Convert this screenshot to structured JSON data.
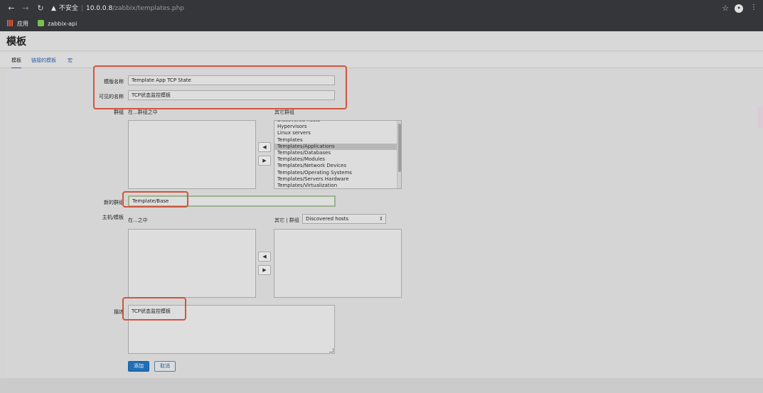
{
  "browser": {
    "security_label": "不安全",
    "url_host": "10.0.0.8",
    "url_path": "/zabbix/templates.php",
    "bookmarks": [
      {
        "label": "应用",
        "icon": "apps-grid-icon"
      },
      {
        "label": "zabbix-api",
        "icon": "zabbix-bookmark-icon"
      }
    ]
  },
  "page": {
    "title": "模板"
  },
  "tabs": [
    {
      "label": "模板",
      "active": true
    },
    {
      "label": "链接的模板",
      "active": false
    },
    {
      "label": "宏",
      "active": false
    }
  ],
  "form": {
    "template_name_label": "模版名称",
    "template_name_value": "Template App TCP State",
    "visible_name_label": "可见的名称",
    "visible_name_value": "TCP状态监控模板",
    "groups_label": "群组",
    "groups_in_label": "在...群组之中",
    "groups_other_label": "其它群组",
    "other_groups": [
      "Discovered hosts",
      "Hypervisors",
      "Linux servers",
      "Templates",
      "Templates/Applications",
      "Templates/Databases",
      "Templates/Modules",
      "Templates/Network Devices",
      "Templates/Operating Systems",
      "Templates/Servers Hardware",
      "Templates/Virtualization"
    ],
    "selected_group": "Templates/Applications",
    "move_left_symbol": "◀",
    "move_right_symbol": "▶",
    "new_group_label": "新的群组",
    "new_group_value": "Template/Base",
    "hosts_label": "主机/模板",
    "hosts_in_label": "在...之中",
    "hosts_other_label": "其它 | 群组",
    "hosts_group_select": "Discovered hosts",
    "description_label": "描述",
    "description_value": "TCP状态监控模板",
    "add_button": "添加",
    "cancel_button": "取消"
  },
  "colors": {
    "highlight": "#d0553d",
    "primary_button": "#1f6fb5",
    "link": "#2b5fa0"
  }
}
